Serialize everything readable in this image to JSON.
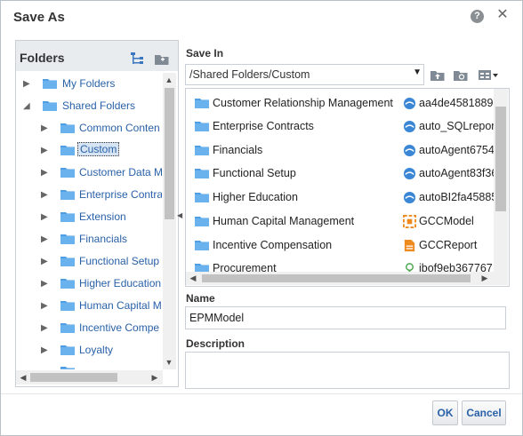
{
  "dialog": {
    "title": "Save As",
    "help_icon": "question-icon",
    "close_icon": "close-icon"
  },
  "folders": {
    "title": "Folders",
    "tree": [
      {
        "label": "My Folders",
        "level": 0,
        "state": "collapsed"
      },
      {
        "label": "Shared Folders",
        "level": 0,
        "state": "expanded"
      },
      {
        "label": "Common Conten",
        "level": 1,
        "state": "collapsed"
      },
      {
        "label": "Custom",
        "level": 1,
        "state": "collapsed",
        "selected": true
      },
      {
        "label": "Customer Data M",
        "level": 1,
        "state": "collapsed"
      },
      {
        "label": "Enterprise Contra",
        "level": 1,
        "state": "collapsed"
      },
      {
        "label": "Extension",
        "level": 1,
        "state": "collapsed"
      },
      {
        "label": "Financials",
        "level": 1,
        "state": "collapsed"
      },
      {
        "label": "Functional Setup",
        "level": 1,
        "state": "collapsed"
      },
      {
        "label": "Higher Education",
        "level": 1,
        "state": "collapsed"
      },
      {
        "label": "Human Capital M",
        "level": 1,
        "state": "collapsed"
      },
      {
        "label": "Incentive Compe",
        "level": 1,
        "state": "collapsed"
      },
      {
        "label": "Loyalty",
        "level": 1,
        "state": "collapsed"
      }
    ]
  },
  "save_in": {
    "label": "Save In",
    "path": "/Shared Folders/Custom",
    "toolbar_icons": [
      "up-folder-icon",
      "new-folder-icon",
      "view-mode-icon"
    ]
  },
  "file_list": {
    "left_column": [
      {
        "name": "Customer Relationship Management",
        "type": "folder"
      },
      {
        "name": "Enterprise Contracts",
        "type": "folder"
      },
      {
        "name": "Financials",
        "type": "folder"
      },
      {
        "name": "Functional Setup",
        "type": "folder"
      },
      {
        "name": "Higher Education",
        "type": "folder"
      },
      {
        "name": "Human Capital Management",
        "type": "folder"
      },
      {
        "name": "Incentive Compensation",
        "type": "folder"
      },
      {
        "name": "Procurement",
        "type": "folder"
      }
    ],
    "right_column": [
      {
        "name": "aa4de4581889",
        "type": "agent"
      },
      {
        "name": "auto_SQLrepor",
        "type": "agent"
      },
      {
        "name": "autoAgent6754",
        "type": "agent"
      },
      {
        "name": "autoAgent83f36",
        "type": "agent"
      },
      {
        "name": "autoBI2fa45885",
        "type": "agent"
      },
      {
        "name": "GCCModel",
        "type": "model"
      },
      {
        "name": "GCCReport",
        "type": "report"
      },
      {
        "name": "ibof9eb367767",
        "type": "other"
      }
    ]
  },
  "name_field": {
    "label": "Name",
    "value": "EPMModel"
  },
  "description_field": {
    "label": "Description",
    "value": ""
  },
  "buttons": {
    "ok": "OK",
    "cancel": "Cancel"
  },
  "colors": {
    "link": "#2961a8",
    "folder": "#4f9ee3",
    "header_bg": "#e8ecef"
  }
}
